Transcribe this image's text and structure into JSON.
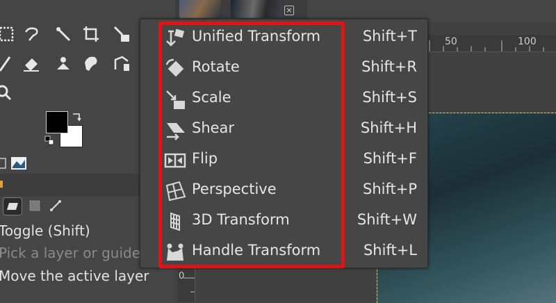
{
  "menu": {
    "items": [
      {
        "label": "Unified Transform",
        "shortcut": "Shift+T",
        "icon": "unified-transform-icon"
      },
      {
        "label": "Rotate",
        "shortcut": "Shift+R",
        "icon": "rotate-icon"
      },
      {
        "label": "Scale",
        "shortcut": "Shift+S",
        "icon": "scale-icon"
      },
      {
        "label": "Shear",
        "shortcut": "Shift+H",
        "icon": "shear-icon"
      },
      {
        "label": "Flip",
        "shortcut": "Shift+F",
        "icon": "flip-icon"
      },
      {
        "label": "Perspective",
        "shortcut": "Shift+P",
        "icon": "perspective-icon"
      },
      {
        "label": "3D Transform",
        "shortcut": "Shift+W",
        "icon": "3d-transform-icon"
      },
      {
        "label": "Handle Transform",
        "shortcut": "Shift+L",
        "icon": "handle-transform-icon"
      }
    ],
    "highlight_color": "#e01414"
  },
  "tool_options": {
    "toggle": "Toggle  (Shift)",
    "pick": "Pick a layer or guide",
    "move": "Move the active layer"
  },
  "ruler": {
    "h_50": "50",
    "h_100": "100",
    "v_0": "0"
  },
  "colors": {
    "foreground": "#000000",
    "background": "#ffffff",
    "canvas_guide": "#d8d84a"
  }
}
